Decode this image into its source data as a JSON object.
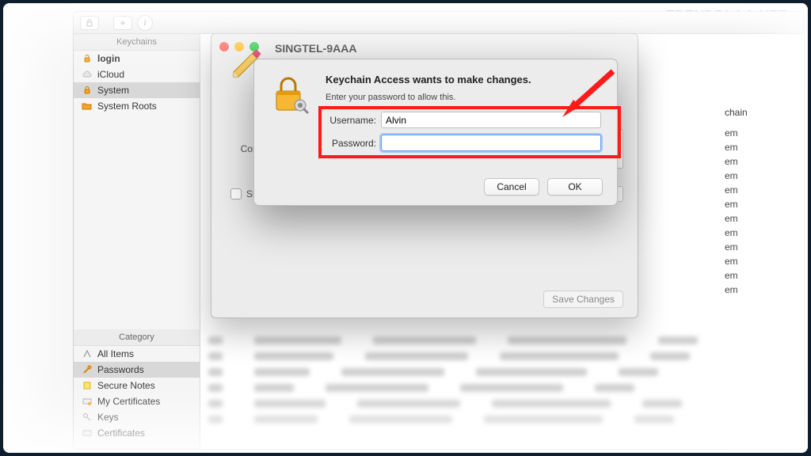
{
  "watermark": "TRENDBLOG.NET",
  "sidebar": {
    "keychains_header": "Keychains",
    "items": [
      {
        "label": "login"
      },
      {
        "label": "iCloud"
      },
      {
        "label": "System"
      },
      {
        "label": "System Roots"
      }
    ],
    "category_header": "Category",
    "categories": [
      {
        "label": "All Items"
      },
      {
        "label": "Passwords"
      },
      {
        "label": "Secure Notes"
      },
      {
        "label": "My Certificates"
      },
      {
        "label": "Keys"
      },
      {
        "label": "Certificates"
      }
    ]
  },
  "info_window": {
    "title": "SINGTEL-9AAA",
    "comments_label": "Comments:",
    "show_password_label": "Show password:",
    "save_button": "Save Changes"
  },
  "column": {
    "header": "chain",
    "cells": [
      "em",
      "em",
      "em",
      "em",
      "em",
      "em",
      "em",
      "em",
      "em",
      "em",
      "em",
      "em"
    ]
  },
  "auth": {
    "title": "Keychain Access wants to make changes.",
    "subtitle": "Enter your password to allow this.",
    "username_label": "Username:",
    "username_value": "Alvin",
    "password_label": "Password:",
    "password_value": "",
    "cancel": "Cancel",
    "ok": "OK"
  }
}
